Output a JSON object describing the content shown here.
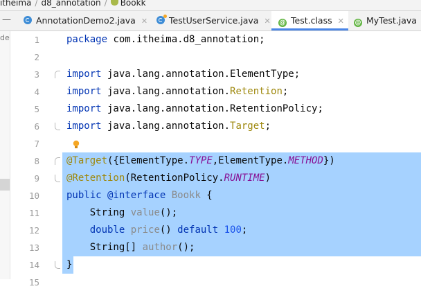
{
  "breadcrumb": {
    "items": [
      {
        "label": "itheima"
      },
      {
        "label": "d8_annotation"
      },
      {
        "label": "Bookk"
      }
    ]
  },
  "tabs": [
    {
      "label": "AnnotationDemo2.java",
      "icon": "java-class-icon",
      "active": false
    },
    {
      "label": "TestUserService.java",
      "icon": "java-class-icon",
      "active": false
    },
    {
      "label": "Test.class",
      "icon": "annotation-class-icon",
      "active": true
    },
    {
      "label": "MyTest.java",
      "icon": "annotation-java-icon",
      "active": false
    }
  ],
  "sidebar_fragment": "de\\j",
  "line_numbers": [
    "1",
    "2",
    "3",
    "4",
    "5",
    "6",
    "7",
    "8",
    "9",
    "10",
    "11",
    "12",
    "13",
    "14",
    "15"
  ],
  "code": {
    "l1": {
      "kw": "package",
      "rest": " com.itheima.d8_annotation;"
    },
    "l3": {
      "kw": "import",
      "rest": " java.lang.annotation.ElementType;"
    },
    "l4": {
      "kw": "import",
      "pre": " java.lang.annotation.",
      "ann": "Retention",
      "post": ";"
    },
    "l5": {
      "kw": "import",
      "rest": " java.lang.annotation.RetentionPolicy;"
    },
    "l6": {
      "kw": "import",
      "pre": " java.lang.annotation.",
      "ann": "Target",
      "post": ";"
    },
    "l8": {
      "ann": "@Target",
      "p1": "({ElementType.",
      "it1": "TYPE",
      "p2": ",ElementType.",
      "it2": "METHOD",
      "p3": "})"
    },
    "l9": {
      "ann": "@Retention",
      "p1": "(RetentionPolicy.",
      "it1": "RUNTIME",
      "p2": ")"
    },
    "l10": {
      "kw1": "public",
      "kw2": " @interface",
      "gr": " Bookk",
      "p": " {"
    },
    "l11": {
      "indent": "    ",
      "p1": "String",
      "gr": " value",
      "p2": "();"
    },
    "l12": {
      "indent": "    ",
      "kw1": "double",
      "gr": " price",
      "p1": "()",
      "kw2": " default",
      "num": " 100",
      "p2": ";"
    },
    "l13": {
      "indent": "    ",
      "p1": "String[]",
      "gr": " author",
      "p2": "();"
    },
    "l14": {
      "p": "}"
    }
  },
  "colors": {
    "keyword": "#0033b3",
    "annotation": "#9e880d",
    "static_field": "#871094",
    "selection": "#a6d2ff",
    "unused": "#8a8a8a",
    "number": "#1750eb"
  }
}
